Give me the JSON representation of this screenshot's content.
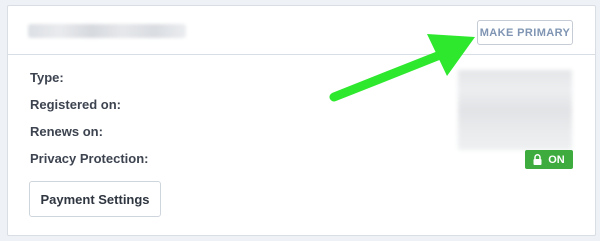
{
  "domain_card": {
    "make_primary_label": "MAKE PRIMARY",
    "fields": {
      "type_label": "Type:",
      "registered_label": "Registered on:",
      "renews_label": "Renews on:",
      "privacy_label": "Privacy Protection:"
    },
    "privacy_status": "ON",
    "payment_settings_label": "Payment Settings"
  },
  "colors": {
    "badge_green": "#3dab3d",
    "accent_text": "#7f95b3",
    "annotation_arrow": "#2ee82e"
  },
  "icons": {
    "privacy_badge": "lock-icon",
    "annotation": "arrow-annotation"
  }
}
